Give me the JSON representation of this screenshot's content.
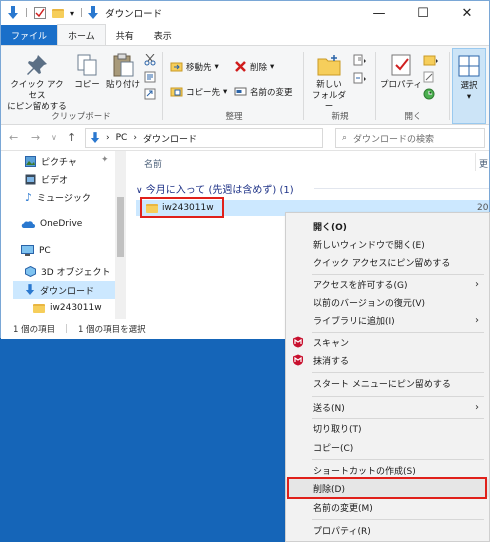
{
  "window": {
    "title": "ダウンロード",
    "controls": [
      "—",
      "☐",
      "✕"
    ]
  },
  "tabs": {
    "file": "ファイル",
    "home": "ホーム",
    "share": "共有",
    "view": "表示"
  },
  "ribbon": {
    "clipboard": {
      "pin": "クイック アクセス\nにピン留めする",
      "copy": "コピー",
      "paste": "貼り付け",
      "label": "クリップボード"
    },
    "organize": {
      "move": "移動先",
      "delete": "削除",
      "copy_to": "コピー先",
      "rename": "名前の変更",
      "label": "整理"
    },
    "new": {
      "new_folder": "新しい\nフォルダー",
      "label": "新規"
    },
    "open": {
      "properties": "プロパティ",
      "label": "開く"
    },
    "select": {
      "select": "選択"
    }
  },
  "address": {
    "path_pc": "PC",
    "path_folder": "ダウンロード",
    "search_placeholder": "ダウンロードの検索"
  },
  "nav_pane": {
    "items": [
      "ピクチャ",
      "ビデオ",
      "ミュージック",
      "OneDrive",
      "PC",
      "3D オブジェクト",
      "ダウンロード",
      "iw243011w"
    ]
  },
  "content": {
    "column_name": "名前",
    "column_updated": "更",
    "group_header": "今月に入って (先週は含めず) (1)",
    "file_name": "iw243011w",
    "file_date": "20"
  },
  "status": {
    "item_count": "1 個の項目",
    "selected": "1 個の項目を選択"
  },
  "context_menu": {
    "open": "開く(O)",
    "open_new_window": "新しいウィンドウで開く(E)",
    "pin_quick_access": "クイック アクセスにピン留めする",
    "give_access": "アクセスを許可する(G)",
    "restore_versions": "以前のバージョンの復元(V)",
    "add_to_library": "ライブラリに追加(I)",
    "scan": "スキャン",
    "shred": "抹消する",
    "pin_start": "スタート メニューにピン留めする",
    "send_to": "送る(N)",
    "cut": "切り取り(T)",
    "copy": "コピー(C)",
    "create_shortcut": "ショートカットの作成(S)",
    "delete": "削除(D)",
    "rename": "名前の変更(M)",
    "properties": "プロパティ(R)"
  },
  "colors": {
    "accent": "#1a6fc9",
    "highlight": "#e0201a",
    "selection": "#cce8ff",
    "desktop": "#1565b8"
  }
}
